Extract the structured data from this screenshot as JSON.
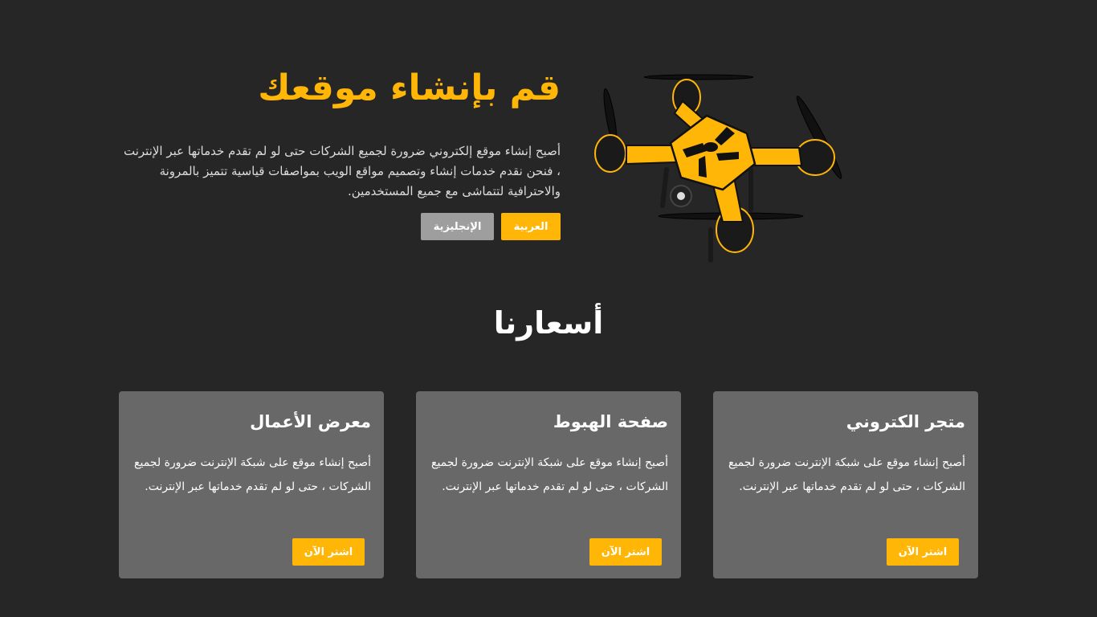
{
  "colors": {
    "background": "#262626",
    "accent": "#ffb606",
    "card": "#686868",
    "secondary_button": "#9e9e9e"
  },
  "hero": {
    "title": "قم بإنشاء موقعك",
    "description": "أصبح إنشاء موقع إلكتروني ضرورة لجميع الشركات حتى لو لم تقدم خدماتها عبر الإنترنت ، فنحن نقدم خدمات إنشاء وتصميم مواقع الويب بمواصفات قياسية تتميز بالمرونة والاحترافية لتتماشى مع جميع المستخدمين.",
    "buttons": {
      "arabic": "العربية",
      "english": "الإنجليزية"
    },
    "image": "drone"
  },
  "prices": {
    "title": "أسعارنا",
    "cards": [
      {
        "title": "متجر الكتروني",
        "description": "أصبح إنشاء موقع على شبكة الإنترنت ضرورة لجميع الشركات ، حتى لو لم تقدم خدماتها عبر الإنترنت.",
        "button": "اشتر الآن"
      },
      {
        "title": "صفحة الهبوط",
        "description": "أصبح إنشاء موقع على شبكة الإنترنت ضرورة لجميع الشركات ، حتى لو لم تقدم خدماتها عبر الإنترنت.",
        "button": "اشتر الآن"
      },
      {
        "title": "معرض الأعمال",
        "description": "أصبح إنشاء موقع على شبكة الإنترنت ضرورة لجميع الشركات ، حتى لو لم تقدم خدماتها عبر الإنترنت.",
        "button": "اشتر الآن"
      }
    ]
  }
}
